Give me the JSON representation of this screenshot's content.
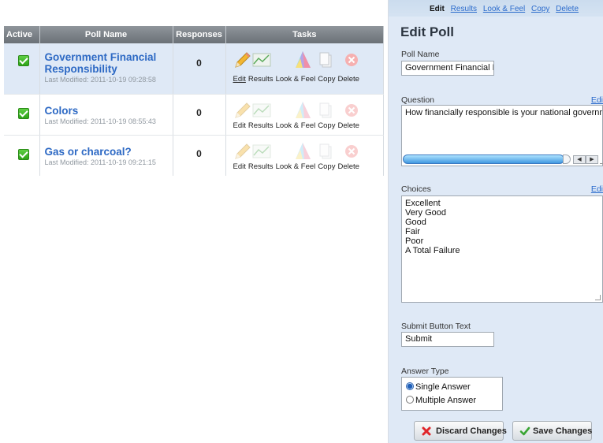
{
  "table": {
    "headers": {
      "active": "Active",
      "poll_name": "Poll Name",
      "responses": "Responses",
      "tasks": "Tasks"
    },
    "task_labels": {
      "edit": "Edit",
      "results": "Results",
      "look_feel": "Look & Feel",
      "copy": "Copy",
      "delete": "Delete"
    },
    "rows": [
      {
        "name_line1": "Government Financial",
        "name_line2": "Responsibility",
        "modified": "Last Modified: 2011-10-19 09:28:58",
        "responses": "0",
        "active": true
      },
      {
        "name_line1": "Colors",
        "name_line2": "",
        "modified": "Last Modified: 2011-10-19 08:55:43",
        "responses": "0",
        "active": true
      },
      {
        "name_line1": "Gas or charcoal?",
        "name_line2": "",
        "modified": "Last Modified: 2011-10-19 09:21:15",
        "responses": "0",
        "active": true
      }
    ]
  },
  "panel": {
    "tabs": {
      "edit": "Edit",
      "results": "Results",
      "look_feel": "Look & Feel",
      "copy": "Copy",
      "delete": "Delete"
    },
    "title": "Edit Poll",
    "poll_name_label": "Poll Name",
    "poll_name_value": "Government Financial F",
    "question_label": "Question",
    "question_edit": "Edi",
    "question_value": "How financially responsible is your national governme",
    "choices_label": "Choices",
    "choices_edit": "Edi",
    "choices": [
      "Excellent",
      "Very Good",
      "Good",
      "Fair",
      "Poor",
      "A Total Failure"
    ],
    "submit_label": "Submit Button Text",
    "submit_value": "Submit",
    "answer_type_label": "Answer Type",
    "answer_single": "Single Answer",
    "answer_multiple": "Multiple Answer",
    "discard": "Discard Changes",
    "save": "Save Changes"
  },
  "colors": {
    "accent": "#2d69c4",
    "panel_bg": "#dfe9f6",
    "check_green": "#2da317",
    "delete_red": "#e0262a"
  }
}
